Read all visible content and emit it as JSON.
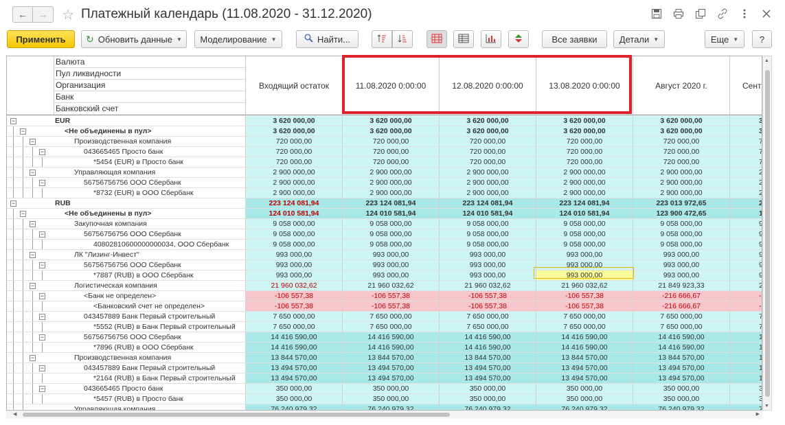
{
  "window": {
    "title": "Платежный календарь (11.08.2020 - 31.12.2020)",
    "back_glyph": "←",
    "forward_glyph": "→",
    "star_glyph": "☆",
    "icons": [
      "save-icon",
      "print-icon",
      "copy-icon",
      "link-icon",
      "menu-icon",
      "close-icon"
    ]
  },
  "toolbar": {
    "apply": "Применить",
    "refresh": "Обновить данные",
    "modeling": "Моделирование",
    "find": "Найти...",
    "all_requests": "Все заявки",
    "details": "Детали",
    "more": "Еще",
    "help": "?"
  },
  "grid": {
    "dimension_headers": [
      "Валюта",
      "Пул ликвидности",
      "Организация",
      "Банк",
      "Банковский счет"
    ],
    "columns": [
      "Входящий остаток",
      "11.08.2020 0:00:00",
      "12.08.2020 0:00:00",
      "13.08.2020 0:00:00",
      "Август 2020 г.",
      "Сент"
    ],
    "rows": [
      {
        "name": "EUR",
        "bold": true,
        "values": [
          "3 620 000,00",
          "3 620 000,00",
          "3 620 000,00",
          "3 620 000,00",
          "3 620 000,00",
          "3"
        ]
      },
      {
        "name": "<Не объединены в пул>",
        "bold": true,
        "values": [
          "3 620 000,00",
          "3 620 000,00",
          "3 620 000,00",
          "3 620 000,00",
          "3 620 000,00",
          "3"
        ]
      },
      {
        "name": "Производственная компания",
        "values": [
          "720 000,00",
          "720 000,00",
          "720 000,00",
          "720 000,00",
          "720 000,00",
          "7"
        ]
      },
      {
        "name": "043665465 Просто банк",
        "values": [
          "720 000,00",
          "720 000,00",
          "720 000,00",
          "720 000,00",
          "720 000,00",
          "7"
        ]
      },
      {
        "name": "*5454 (EUR) в Просто банк",
        "values": [
          "720 000,00",
          "720 000,00",
          "720 000,00",
          "720 000,00",
          "720 000,00",
          "7"
        ]
      },
      {
        "name": "Управляющая компания",
        "values": [
          "2 900 000,00",
          "2 900 000,00",
          "2 900 000,00",
          "2 900 000,00",
          "2 900 000,00",
          "2"
        ]
      },
      {
        "name": "56756756756 ООО Сбербанк",
        "values": [
          "2 900 000,00",
          "2 900 000,00",
          "2 900 000,00",
          "2 900 000,00",
          "2 900 000,00",
          "2"
        ]
      },
      {
        "name": "*8732 (EUR) в ООО Сбербанк",
        "values": [
          "2 900 000,00",
          "2 900 000,00",
          "2 900 000,00",
          "2 900 000,00",
          "2 900 000,00",
          "2"
        ]
      },
      {
        "name": "RUB",
        "bold": true,
        "values": [
          "223 124 081,94",
          "223 124 081,94",
          "223 124 081,94",
          "223 124 081,94",
          "223 013 972,65",
          "222"
        ]
      },
      {
        "name": "<Не объединены в пул>",
        "bold": true,
        "values": [
          "124 010 581,94",
          "124 010 581,94",
          "124 010 581,94",
          "124 010 581,94",
          "123 900 472,65",
          "123"
        ]
      },
      {
        "name": "Закупочная компания",
        "values": [
          "9 058 000,00",
          "9 058 000,00",
          "9 058 000,00",
          "9 058 000,00",
          "9 058 000,00",
          "9"
        ]
      },
      {
        "name": "56756756756 ООО Сбербанк",
        "values": [
          "9 058 000,00",
          "9 058 000,00",
          "9 058 000,00",
          "9 058 000,00",
          "9 058 000,00",
          "9"
        ]
      },
      {
        "name": "40802810600000000034, ООО Сбербанк",
        "values": [
          "9 058 000,00",
          "9 058 000,00",
          "9 058 000,00",
          "9 058 000,00",
          "9 058 000,00",
          "9"
        ]
      },
      {
        "name": "ЛК \"Лизинг-Инвест\"",
        "values": [
          "993 000,00",
          "993 000,00",
          "993 000,00",
          "993 000,00",
          "993 000,00",
          "9"
        ]
      },
      {
        "name": "56756756756 ООО Сбербанк",
        "values": [
          "993 000,00",
          "993 000,00",
          "993 000,00",
          "993 000,00",
          "993 000,00",
          "9"
        ]
      },
      {
        "name": "*7887 (RUB) в ООО Сбербанк",
        "values": [
          "993 000,00",
          "993 000,00",
          "993 000,00",
          "993 000,00",
          "993 000,00",
          "9"
        ]
      },
      {
        "name": "Логистическая компания",
        "values": [
          "21 960 032,62",
          "21 960 032,62",
          "21 960 032,62",
          "21 960 032,62",
          "21 849 923,33",
          "21"
        ]
      },
      {
        "name": "<Банк не определен>",
        "values": [
          "-106 557,38",
          "-106 557,38",
          "-106 557,38",
          "-106 557,38",
          "-216 666,67",
          "-"
        ]
      },
      {
        "name": "<Банковский счет не определен>",
        "values": [
          "-106 557,38",
          "-106 557,38",
          "-106 557,38",
          "-106 557,38",
          "-216 666,67",
          "-"
        ]
      },
      {
        "name": "043457889 Банк Первый строительный",
        "values": [
          "7 650 000,00",
          "7 650 000,00",
          "7 650 000,00",
          "7 650 000,00",
          "7 650 000,00",
          "7"
        ]
      },
      {
        "name": "*5552 (RUB) в Банк Первый строительный",
        "values": [
          "7 650 000,00",
          "7 650 000,00",
          "7 650 000,00",
          "7 650 000,00",
          "7 650 000,00",
          "7"
        ]
      },
      {
        "name": "56756756756 ООО Сбербанк",
        "values": [
          "14 416 590,00",
          "14 416 590,00",
          "14 416 590,00",
          "14 416 590,00",
          "14 416 590,00",
          "14"
        ]
      },
      {
        "name": "*7896 (RUB) в ООО Сбербанк",
        "values": [
          "14 416 590,00",
          "14 416 590,00",
          "14 416 590,00",
          "14 416 590,00",
          "14 416 590,00",
          "14"
        ]
      },
      {
        "name": "Производственная компания",
        "values": [
          "13 844 570,00",
          "13 844 570,00",
          "13 844 570,00",
          "13 844 570,00",
          "13 844 570,00",
          "13"
        ]
      },
      {
        "name": "043457889 Банк Первый строительный",
        "values": [
          "13 494 570,00",
          "13 494 570,00",
          "13 494 570,00",
          "13 494 570,00",
          "13 494 570,00",
          "13"
        ]
      },
      {
        "name": "*2164 (RUB) в Банк Первый строительный",
        "values": [
          "13 494 570,00",
          "13 494 570,00",
          "13 494 570,00",
          "13 494 570,00",
          "13 494 570,00",
          "13"
        ]
      },
      {
        "name": "043665465 Просто банк",
        "values": [
          "350 000,00",
          "350 000,00",
          "350 000,00",
          "350 000,00",
          "350 000,00",
          "3"
        ]
      },
      {
        "name": "*5457 (RUB) в Просто банк",
        "values": [
          "350 000,00",
          "350 000,00",
          "350 000,00",
          "350 000,00",
          "350 000,00",
          "3"
        ]
      },
      {
        "name": "Управляющая компания",
        "values": [
          "76 240 979,32",
          "76 240 979,32",
          "76 240 979,32",
          "76 240 979,32",
          "76 240 979,32",
          "76"
        ]
      }
    ]
  }
}
